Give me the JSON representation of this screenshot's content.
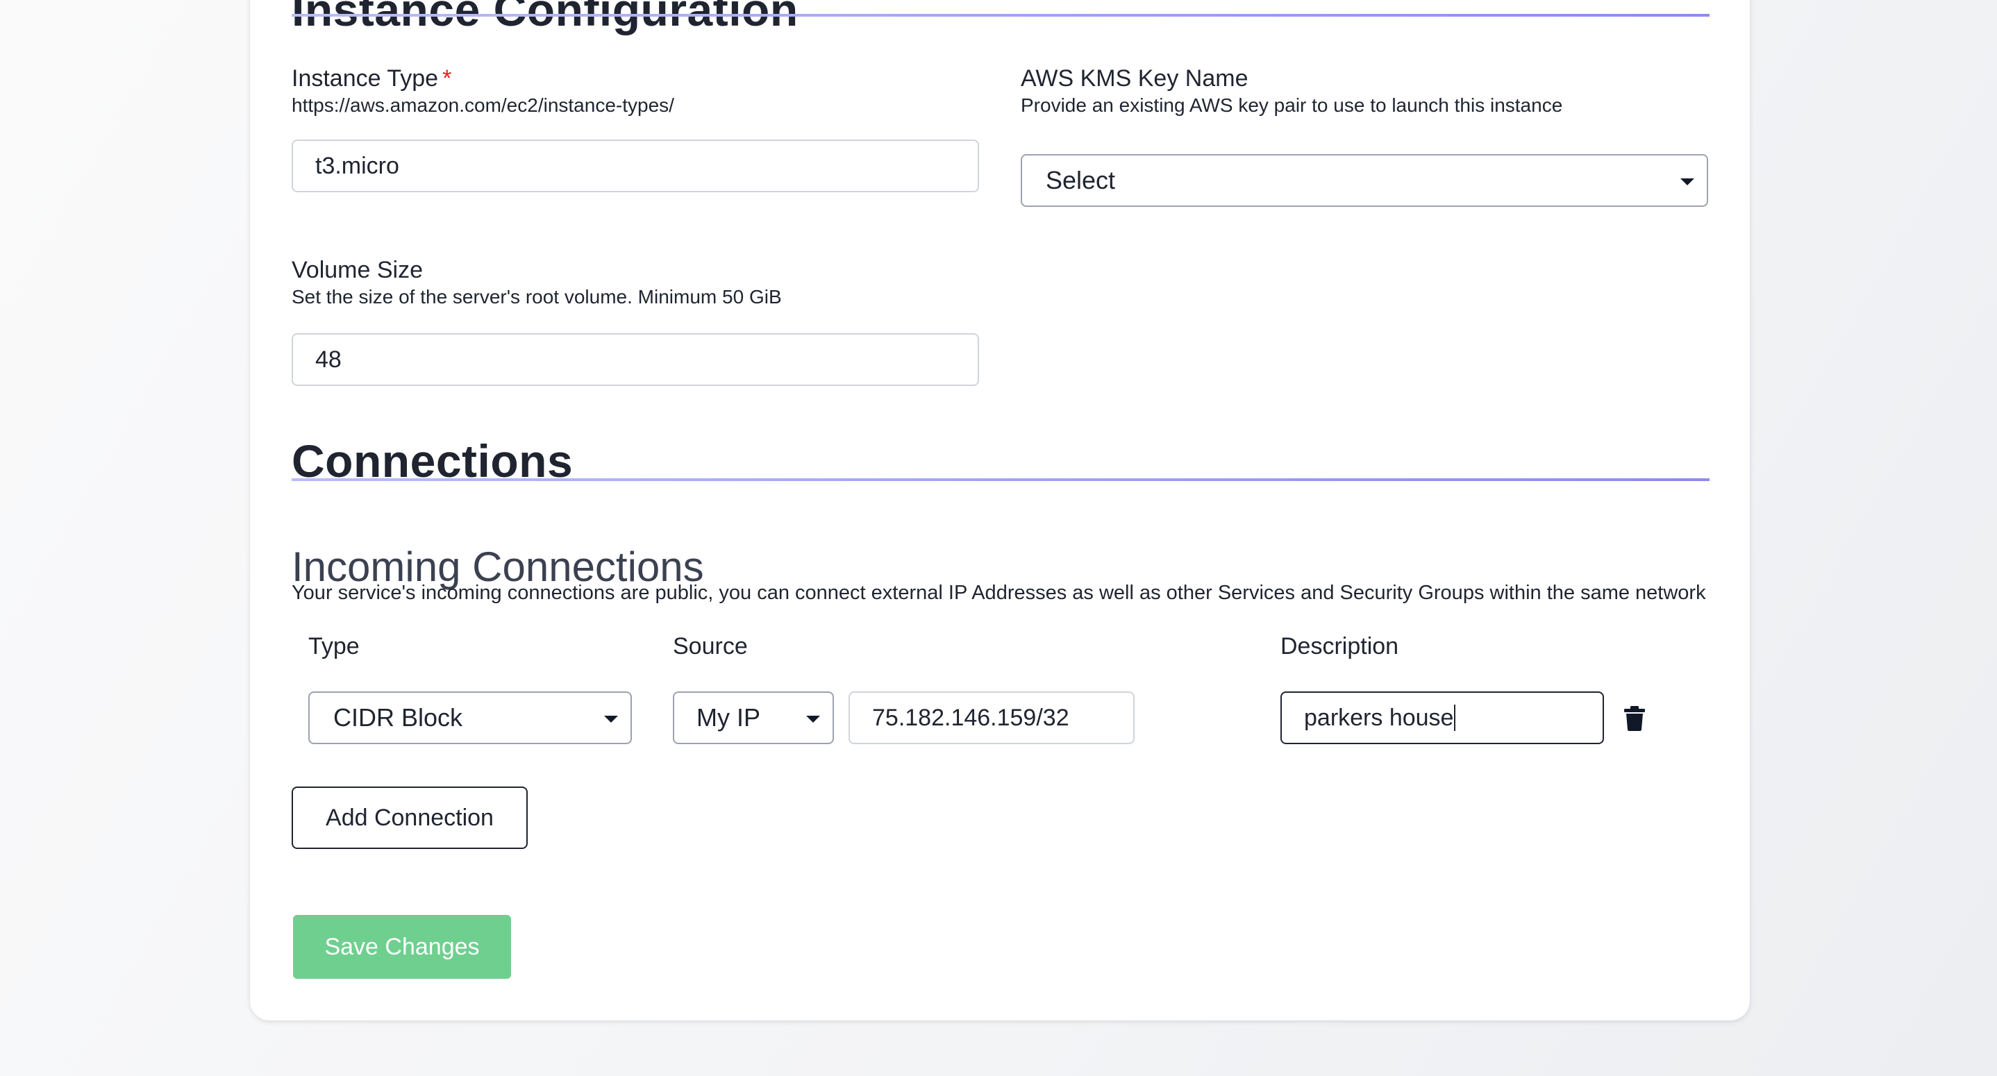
{
  "instance_config": {
    "title": "Instance Configuration",
    "instance_type": {
      "label": "Instance Type",
      "required_mark": "*",
      "help": "https://aws.amazon.com/ec2/instance-types/",
      "value": "t3.micro"
    },
    "kms_key": {
      "label": "AWS KMS Key Name",
      "help": "Provide an existing AWS key pair to use to launch this instance",
      "selected": "Select"
    },
    "volume_size": {
      "label": "Volume Size",
      "help": "Set the size of the server's root volume. Minimum 50 GiB",
      "value": "48"
    }
  },
  "connections": {
    "title": "Connections",
    "incoming": {
      "title": "Incoming Connections",
      "description": "Your service's incoming connections are public, you can connect external IP Addresses as well as other Services and Security Groups within the same network",
      "columns": {
        "type": "Type",
        "source": "Source",
        "description": "Description"
      },
      "rows": [
        {
          "type": "CIDR Block",
          "source": "My IP",
          "cidr": "75.182.146.159/32",
          "description": "parkers house"
        }
      ]
    },
    "add_label": "Add Connection"
  },
  "save_label": "Save Changes",
  "icons": {
    "delete": "trash-icon",
    "dropdown": "chevron-down-icon"
  },
  "colors": {
    "save_button": "#6fcf8f",
    "required": "#dc2626",
    "section_rule": "#8f8af0"
  }
}
